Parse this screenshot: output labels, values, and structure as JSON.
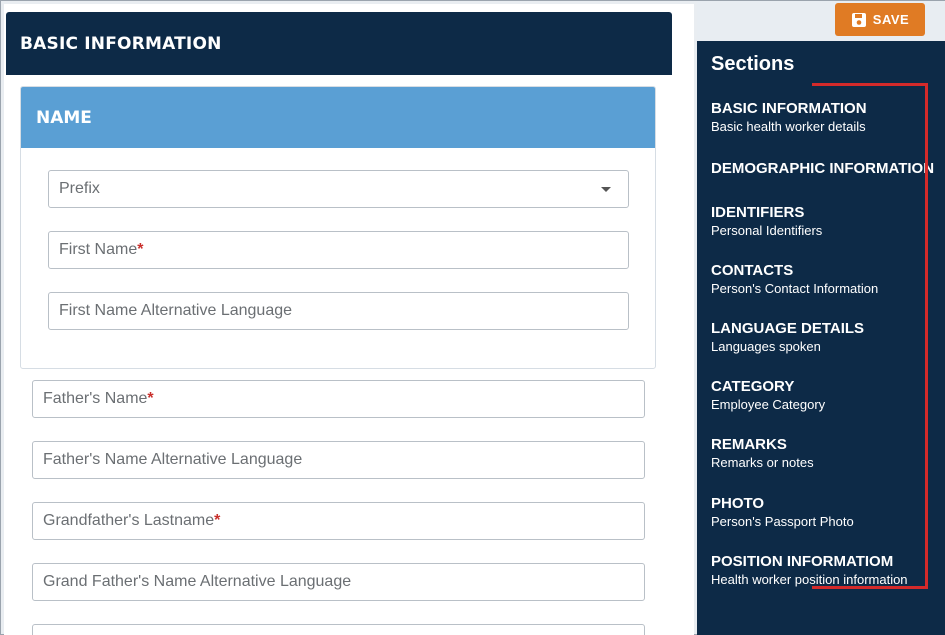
{
  "main": {
    "header_title": "BASIC INFORMATION",
    "name_card": {
      "title": "NAME",
      "prefix_placeholder": "Prefix",
      "first_name_placeholder": "First Name",
      "first_name_alt_placeholder": "First Name Alternative Language"
    },
    "fathers_name_placeholder": "Father's Name",
    "fathers_name_alt_placeholder": "Father's Name Alternative Language",
    "grandfathers_lastname_placeholder": "Grandfather's Lastname",
    "grandfathers_name_alt_placeholder": "Grand Father's Name Alternative Language",
    "required_mark": "*"
  },
  "toolbar": {
    "save_label": "SAVE",
    "save_color": "#e07b24"
  },
  "sidebar": {
    "title": "Sections",
    "items": [
      {
        "title": "BASIC INFORMATION",
        "subtitle": "Basic health worker details"
      },
      {
        "title": "DEMOGRAPHIC INFORMATION",
        "subtitle": ""
      },
      {
        "title": "IDENTIFIERS",
        "subtitle": "Personal Identifiers"
      },
      {
        "title": "CONTACTS",
        "subtitle": "Person's Contact Information"
      },
      {
        "title": "LANGUAGE DETAILS",
        "subtitle": "Languages spoken"
      },
      {
        "title": "CATEGORY",
        "subtitle": "Employee Category"
      },
      {
        "title": "REMARKS",
        "subtitle": "Remarks or notes"
      },
      {
        "title": "PHOTO",
        "subtitle": "Person's Passport Photo"
      },
      {
        "title": "POSITION INFORMATIOM",
        "subtitle": "Health worker position information"
      }
    ]
  },
  "colors": {
    "navy": "#0d2a47",
    "name_header": "#5a9fd4",
    "highlight": "#d42a2a"
  }
}
